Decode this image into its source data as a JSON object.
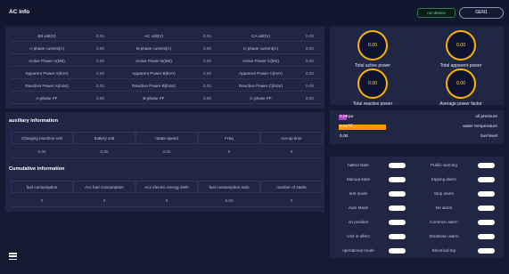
{
  "header": {
    "title": "AC info",
    "device_label": "run device",
    "generator_button": "GEN1"
  },
  "ac_table": [
    [
      "B8 volt(V)",
      "0.00",
      "AC volt(V)",
      "0.00",
      "CA volt(V)",
      "0.00"
    ],
    [
      "A-phase current(A)",
      "0.00",
      "B-phase current(A)",
      "0.00",
      "C-phase current(A)",
      "0.00"
    ],
    [
      "Active Power A(kW)",
      "0.00",
      "Active Power B(kW)",
      "0.00",
      "Active Power C(kW)",
      "0.00"
    ],
    [
      "Apparent Power A(kVA)",
      "0.00",
      "Apparent Power B(kVA)",
      "0.00",
      "Apparent Power C(kVA)",
      "0.00"
    ],
    [
      "Reactive Power A(kVar)",
      "0.00",
      "Reactive Power B(kVar)",
      "0.00",
      "Reactive Power C(kVar)",
      "0.00"
    ],
    [
      "A-phase PF",
      "0.00",
      "B-phase PF",
      "0.00",
      "C-phase PF",
      "0.00"
    ]
  ],
  "auxiliary": {
    "title": "auxiliary information",
    "headers": [
      "Charging machine volt",
      "battery volt",
      "rotate speed",
      "Freq",
      "run-up time"
    ],
    "values": [
      "0.00",
      "0.00",
      "0.00",
      "0",
      "0"
    ]
  },
  "cumulative": {
    "title": "Cumulative information",
    "headers": [
      "fuel consumption",
      "Acc fuel consumption",
      "Acc electric energy kWh",
      "fuel consumption ratio",
      "number of starts"
    ],
    "values": [
      "0",
      "0",
      "0",
      "0.00",
      "0"
    ]
  },
  "gauges": [
    {
      "value": "0.00",
      "label": "Total active power"
    },
    {
      "value": "0.00",
      "label": "Total apparent power"
    },
    {
      "value": "0.00",
      "label": "Total reactive power"
    },
    {
      "value": "0.00",
      "label": "Average power factor"
    }
  ],
  "bars": [
    {
      "value": "0.0Kpa",
      "label": "oil pressure",
      "fill": 0.05,
      "color": "#b13fc4"
    },
    {
      "value": "0.00℃",
      "label": "water temperature",
      "fill": 0.3,
      "color": "#ff9800"
    },
    {
      "value": "0.00",
      "label": "fuel level",
      "fill": 0.0,
      "color": "#4caf50"
    }
  ],
  "status": {
    "left": [
      "halted state",
      "Manual state",
      "test mode",
      "Auto Mode",
      "on position",
      "Unit in effect",
      "operational mode"
    ],
    "right": [
      "Public warning",
      "tripping alarm",
      "Stop alarm",
      "No alarm",
      "Common alarm",
      "Shutdown alarm",
      "Electrical trip"
    ]
  },
  "colors": {
    "background": "#151a33",
    "panel": "#202745",
    "gauge_ring": "#ffb300",
    "gauge_text": "#ffd54a",
    "toggle": "#ffffff"
  }
}
